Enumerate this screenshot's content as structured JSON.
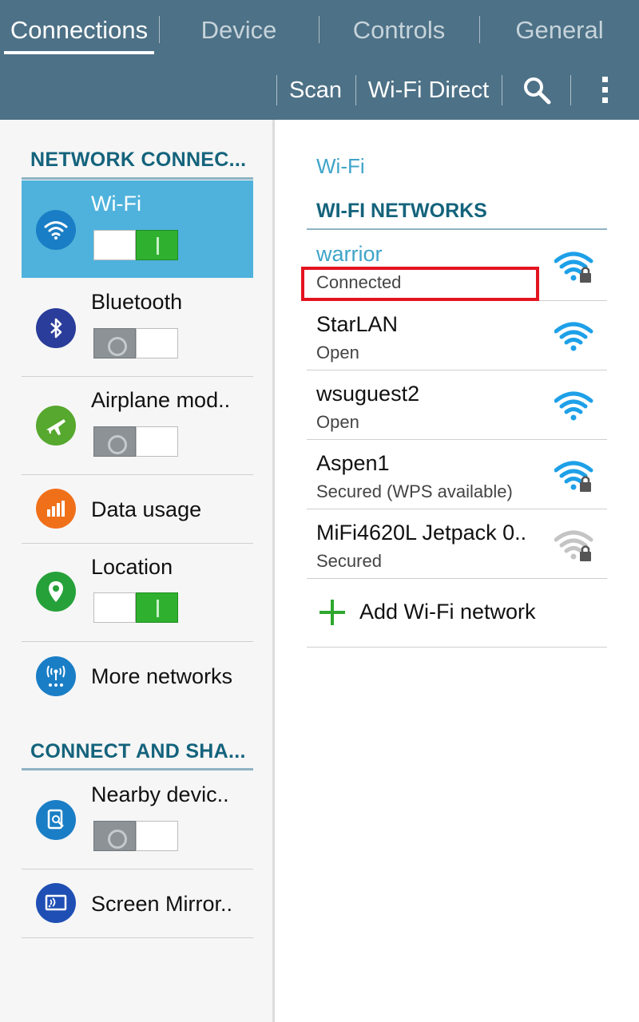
{
  "tabs": [
    {
      "label": "Connections",
      "active": true
    },
    {
      "label": "Device",
      "active": false
    },
    {
      "label": "Controls",
      "active": false
    },
    {
      "label": "General",
      "active": false
    }
  ],
  "actions": {
    "scan": "Scan",
    "wifi_direct": "Wi-Fi Direct",
    "search_icon": "search-icon",
    "more_icon": "overflow-menu-icon"
  },
  "left": {
    "section1": "NETWORK CONNEC...",
    "section2": "CONNECT AND SHA...",
    "items": [
      {
        "label": "Wi-Fi",
        "icon": "wifi-icon",
        "icon_color": "#1a7ec6",
        "toggle": "on",
        "selected": true
      },
      {
        "label": "Bluetooth",
        "icon": "bluetooth-icon",
        "icon_color": "#2a3d9a",
        "toggle": "off",
        "selected": false
      },
      {
        "label": "Airplane mod..",
        "icon": "airplane-icon",
        "icon_color": "#56a82e",
        "toggle": "off",
        "selected": false
      },
      {
        "label": "Data usage",
        "icon": "data-usage-icon",
        "icon_color": "#f0701a",
        "toggle": null,
        "selected": false
      },
      {
        "label": "Location",
        "icon": "location-icon",
        "icon_color": "#26a13a",
        "toggle": "on",
        "selected": false
      },
      {
        "label": "More networks",
        "icon": "more-networks-icon",
        "icon_color": "#1a7ec6",
        "toggle": null,
        "selected": false
      },
      {
        "label": "Nearby devic..",
        "icon": "nearby-devices-icon",
        "icon_color": "#1a7ec6",
        "toggle": "off",
        "selected": false
      },
      {
        "label": "Screen Mirror..",
        "icon": "screen-mirroring-icon",
        "icon_color": "#1f4fb4",
        "toggle": null,
        "selected": false
      }
    ]
  },
  "right": {
    "breadcrumb": "Wi-Fi",
    "networks_header": "WI-FI NETWORKS",
    "networks": [
      {
        "name": "warrior",
        "status": "Connected",
        "secured": true,
        "signal_color": "#1ea0e8",
        "connected": true
      },
      {
        "name": "StarLAN",
        "status": "Open",
        "secured": false,
        "signal_color": "#1ea0e8",
        "connected": false
      },
      {
        "name": "wsuguest2",
        "status": "Open",
        "secured": false,
        "signal_color": "#1ea0e8",
        "connected": false
      },
      {
        "name": "Aspen1",
        "status": "Secured (WPS available)",
        "secured": true,
        "signal_color": "#1ea0e8",
        "connected": false
      },
      {
        "name": "MiFi4620L Jetpack 0..",
        "status": "Secured",
        "secured": true,
        "signal_color": "#bdbdbd",
        "connected": false
      }
    ],
    "add_network": "Add Wi-Fi network"
  },
  "colors": {
    "topbar": "#4d7186",
    "accent": "#3fa4c9",
    "selected_row": "#4fb2dc",
    "highlight_box": "#e3141f"
  }
}
